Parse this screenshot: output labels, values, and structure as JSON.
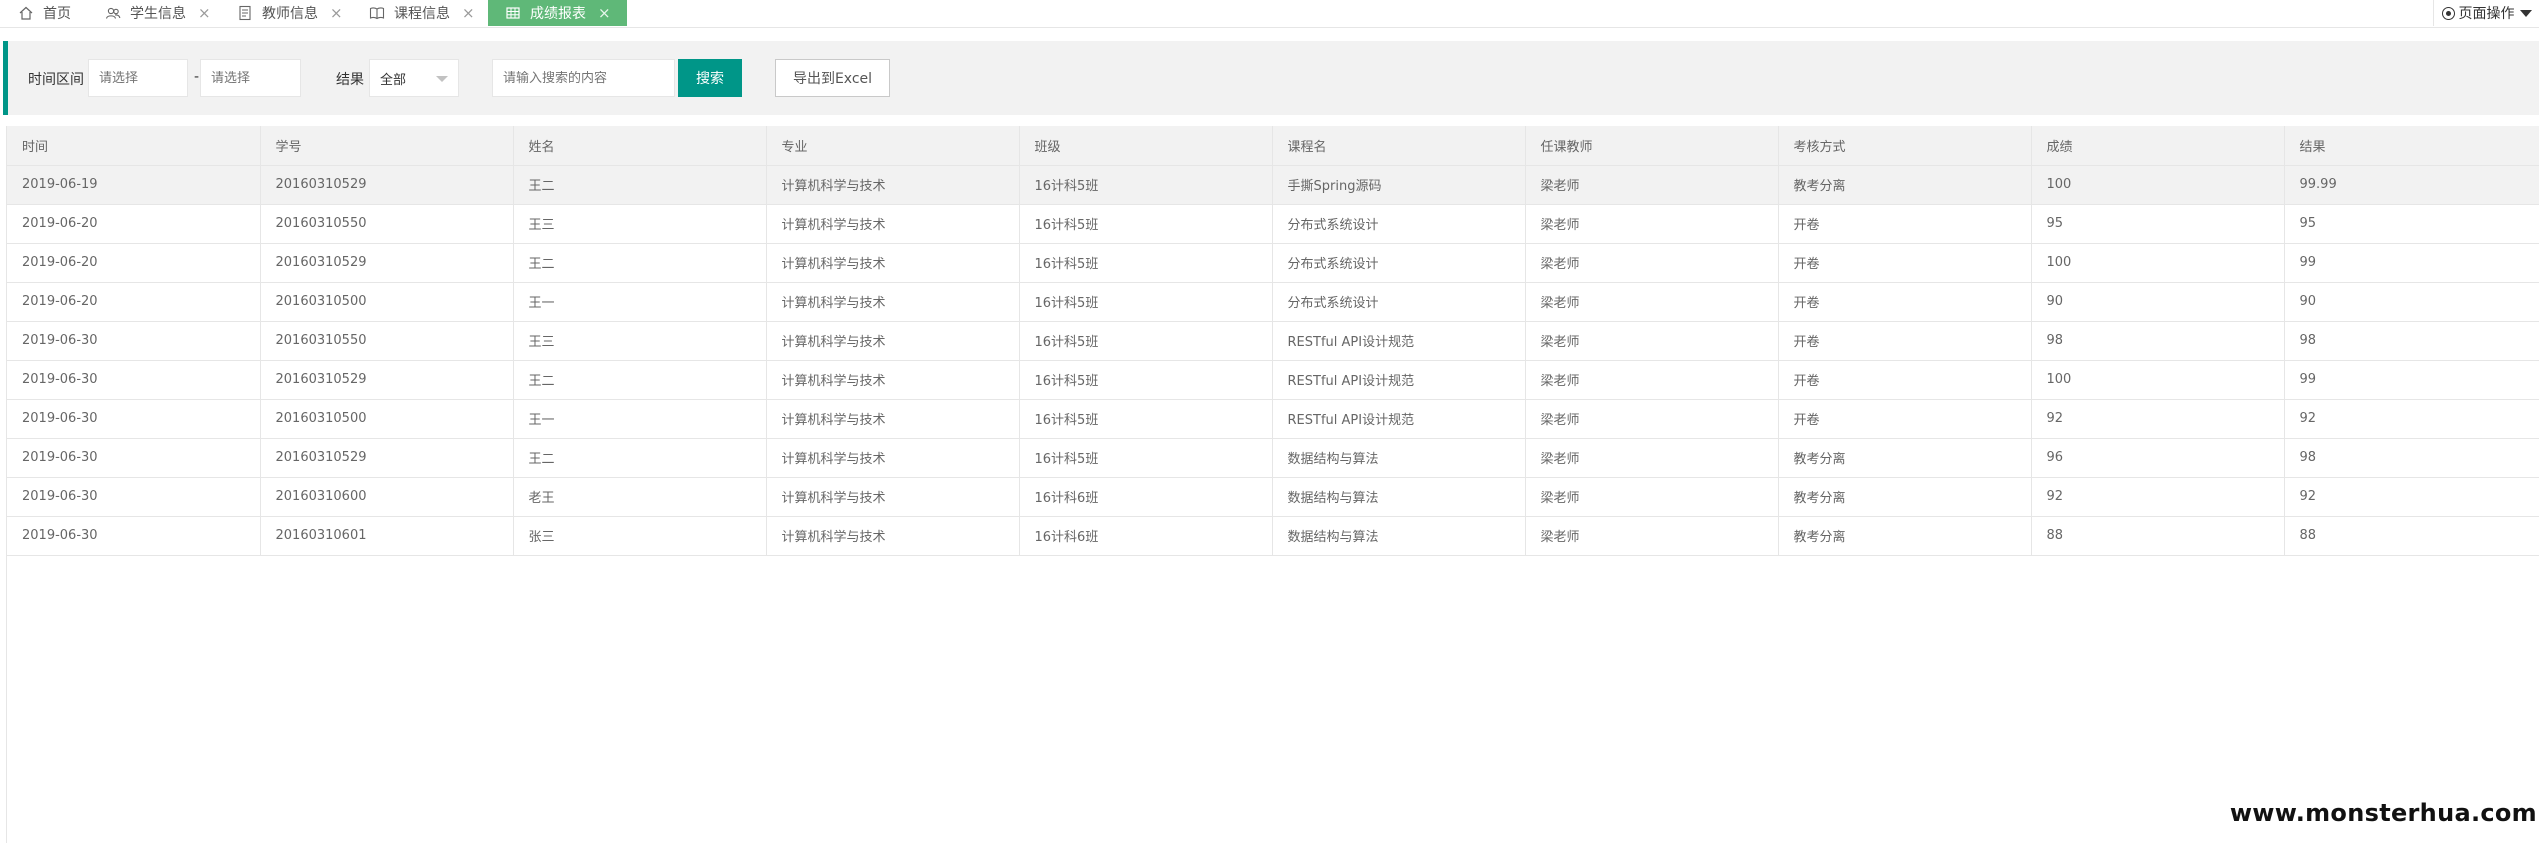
{
  "tabs": [
    {
      "label": "首页",
      "icon": "home-icon",
      "closable": false,
      "active": false
    },
    {
      "label": "学生信息",
      "icon": "users-icon",
      "closable": true,
      "active": false
    },
    {
      "label": "教师信息",
      "icon": "document-icon",
      "closable": true,
      "active": false
    },
    {
      "label": "课程信息",
      "icon": "book-icon",
      "closable": true,
      "active": false
    },
    {
      "label": "成绩报表",
      "icon": "table-icon",
      "closable": true,
      "active": true
    }
  ],
  "tab_close_glyph": "×",
  "page_ops": {
    "label": "页面操作"
  },
  "filter": {
    "time_label": "时间区间",
    "start_placeholder": "请选择",
    "range_separator": "-",
    "end_placeholder": "请选择",
    "result_label": "结果",
    "result_value": "全部",
    "search_placeholder": "请输入搜索的内容",
    "search_button": "搜索",
    "export_button": "导出到Excel"
  },
  "table": {
    "columns": [
      "时间",
      "学号",
      "姓名",
      "专业",
      "班级",
      "课程名",
      "任课教师",
      "考核方式",
      "成绩",
      "结果"
    ],
    "rows": [
      [
        "2019-06-19",
        "20160310529",
        "王二",
        "计算机科学与技术",
        "16计科5班",
        "手撕Spring源码",
        "梁老师",
        "教考分离",
        "100",
        "99.99"
      ],
      [
        "2019-06-20",
        "20160310550",
        "王三",
        "计算机科学与技术",
        "16计科5班",
        "分布式系统设计",
        "梁老师",
        "开卷",
        "95",
        "95"
      ],
      [
        "2019-06-20",
        "20160310529",
        "王二",
        "计算机科学与技术",
        "16计科5班",
        "分布式系统设计",
        "梁老师",
        "开卷",
        "100",
        "99"
      ],
      [
        "2019-06-20",
        "20160310500",
        "王一",
        "计算机科学与技术",
        "16计科5班",
        "分布式系统设计",
        "梁老师",
        "开卷",
        "90",
        "90"
      ],
      [
        "2019-06-30",
        "20160310550",
        "王三",
        "计算机科学与技术",
        "16计科5班",
        "RESTful API设计规范",
        "梁老师",
        "开卷",
        "98",
        "98"
      ],
      [
        "2019-06-30",
        "20160310529",
        "王二",
        "计算机科学与技术",
        "16计科5班",
        "RESTful API设计规范",
        "梁老师",
        "开卷",
        "100",
        "99"
      ],
      [
        "2019-06-30",
        "20160310500",
        "王一",
        "计算机科学与技术",
        "16计科5班",
        "RESTful API设计规范",
        "梁老师",
        "开卷",
        "92",
        "92"
      ],
      [
        "2019-06-30",
        "20160310529",
        "王二",
        "计算机科学与技术",
        "16计科5班",
        "数据结构与算法",
        "梁老师",
        "教考分离",
        "96",
        "98"
      ],
      [
        "2019-06-30",
        "20160310600",
        "老王",
        "计算机科学与技术",
        "16计科6班",
        "数据结构与算法",
        "梁老师",
        "教考分离",
        "92",
        "92"
      ],
      [
        "2019-06-30",
        "20160310601",
        "张三",
        "计算机科学与技术",
        "16计科6班",
        "数据结构与算法",
        "梁老师",
        "教考分离",
        "88",
        "88"
      ]
    ],
    "hover_row": 0
  },
  "watermark": "www.monsterhua.com",
  "colors": {
    "accent": "#009688",
    "active_tab": "#5fb878",
    "panel_bg": "#f2f2f2",
    "border": "#e6e6e6",
    "text": "#666666"
  }
}
